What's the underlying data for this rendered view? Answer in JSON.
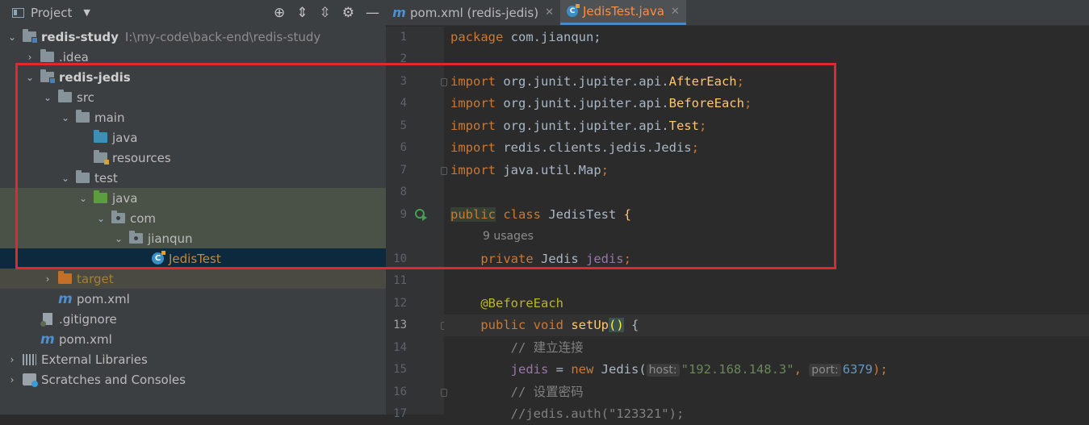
{
  "project_panel": {
    "title": "Project",
    "tree": [
      {
        "label": "redis-study",
        "path": "I:\\my-code\\back-end\\redis-study"
      },
      {
        "label": ".idea"
      },
      {
        "label": "redis-jedis"
      },
      {
        "label": "src"
      },
      {
        "label": "main"
      },
      {
        "label": "java"
      },
      {
        "label": "resources"
      },
      {
        "label": "test"
      },
      {
        "label": "java"
      },
      {
        "label": "com"
      },
      {
        "label": "jianqun"
      },
      {
        "label": "JedisTest"
      },
      {
        "label": "target"
      },
      {
        "label": "pom.xml"
      },
      {
        "label": ".gitignore"
      },
      {
        "label": "pom.xml"
      },
      {
        "label": "External Libraries"
      },
      {
        "label": "Scratches and Consoles"
      }
    ]
  },
  "tabs": [
    {
      "label": "pom.xml (redis-jedis)",
      "icon": "maven-icon",
      "active": false
    },
    {
      "label": "JedisTest.java",
      "icon": "java-class-icon",
      "active": true
    }
  ],
  "editor": {
    "line_numbers": [
      "1",
      "2",
      "3",
      "4",
      "5",
      "6",
      "7",
      "8",
      "9",
      "",
      "10",
      "11",
      "12",
      "13",
      "14",
      "15",
      "16",
      "17"
    ],
    "usages_hint": "9 usages",
    "inlay_host": "host:",
    "inlay_port": "port:",
    "code": {
      "l1_kw": "package",
      "l1_rest": " com.jianqun;",
      "import_kw": "import",
      "l3_pkg": " org.junit.jupiter.api.",
      "l3_cls": "AfterEach",
      "l4_pkg": " org.junit.jupiter.api.",
      "l4_cls": "BeforeEach",
      "l5_pkg": " org.junit.jupiter.api.",
      "l5_cls": "Test",
      "l6_rest": " redis.clients.jedis.Jedis",
      "l7_rest": " java.util.Map",
      "semi": ";",
      "l9_public": "public",
      "l9_class": " class",
      "l9_name": " JedisTest ",
      "l9_brace": "{",
      "l10_private": "private",
      "l10_type": " Jedis ",
      "l10_field": "jedis",
      "l12_ann": "@BeforeEach",
      "l13_public": "public",
      "l13_void": " void ",
      "l13_fn": "setUp",
      "l13_parens": "()",
      "l13_brace": " {",
      "l14_cmt": "// 建立连接",
      "l15_field": "jedis",
      "l15_eq": " = ",
      "l15_new": "new",
      "l15_type": " Jedis(",
      "l15_str": "\"192.168.148.3\"",
      "l15_comma": ", ",
      "l15_num": "6379",
      "l15_end": ");",
      "l16_cmt": "// 设置密码",
      "l17_cmt": "//jedis.auth(\"123321\");"
    }
  },
  "colors": {
    "highlight_box": "#e0282e",
    "editor_bg": "#2b2b2b",
    "panel_bg": "#3c3f41"
  }
}
